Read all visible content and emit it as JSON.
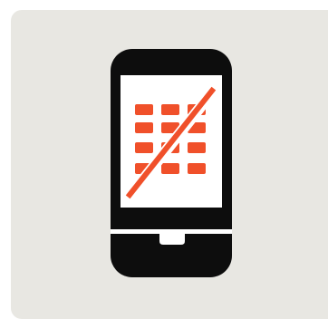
{
  "icon": {
    "name": "no-keypad-phone-icon",
    "colors": {
      "card_background": "#e8e7e2",
      "phone_body": "#0d0d0d",
      "screen": "#ffffff",
      "accent": "#f0502a"
    }
  }
}
